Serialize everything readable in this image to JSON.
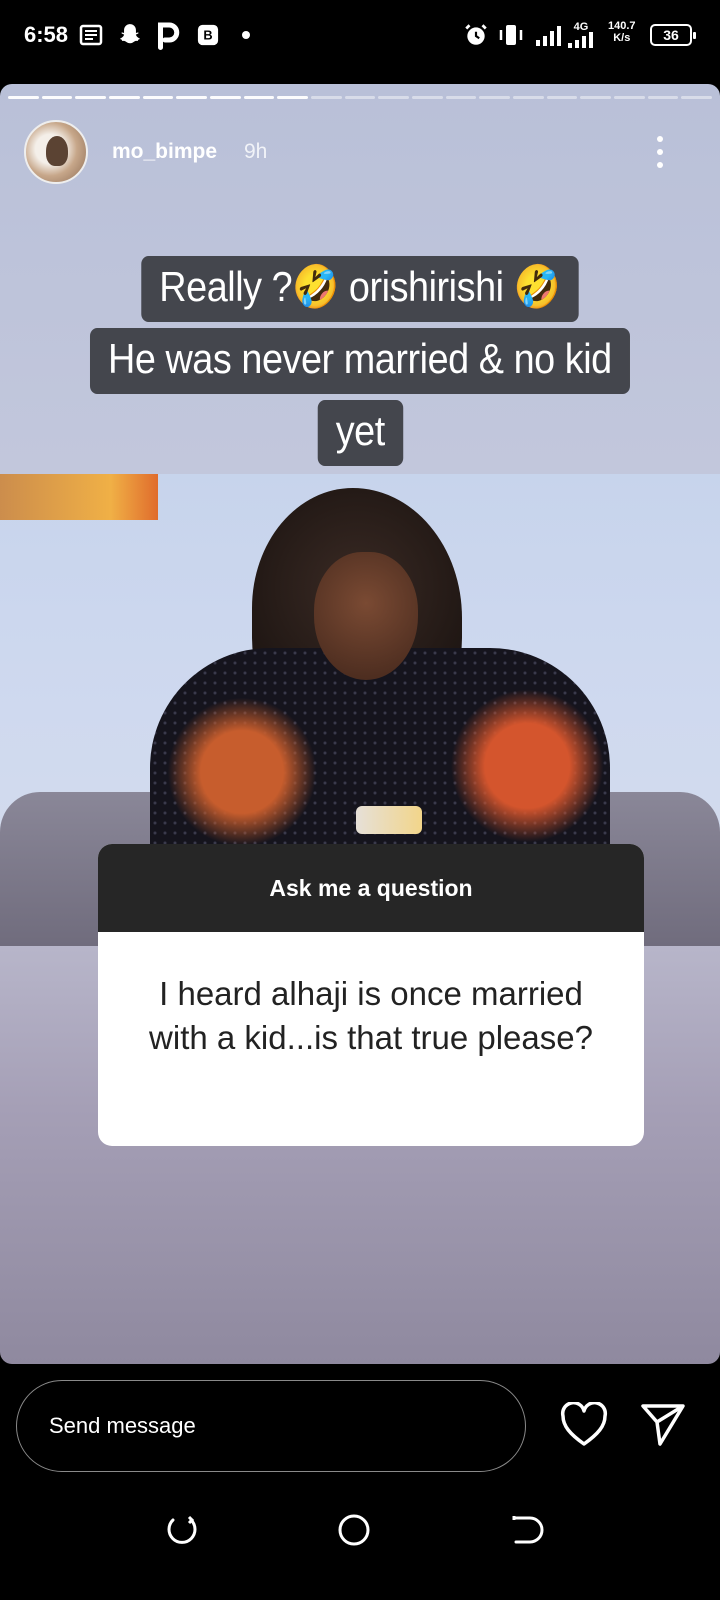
{
  "status_bar": {
    "time": "6:58",
    "network": "4G",
    "speed": "140.7",
    "speed_unit": "K/s",
    "battery": "36",
    "icons": [
      "news-icon",
      "snapchat-icon",
      "p-app-icon",
      "bitcoin-icon",
      "dot-icon",
      "alarm-icon",
      "vibrate-icon",
      "signal-icon",
      "signal-4g-icon",
      "battery-icon"
    ]
  },
  "story": {
    "progress_total": 21,
    "progress_done": 9,
    "username": "mo_bimpe",
    "time_ago": "9h",
    "caption_lines": [
      "Really ?🤣 orishirishi 🤣",
      "He was never married & no kid",
      "yet"
    ],
    "question": {
      "title": "Ask me a question",
      "text": "I heard alhaji is once married with a kid...is that true please?"
    }
  },
  "reply_bar": {
    "placeholder": "Send message"
  },
  "colors": {
    "caption_bg": "#44464d",
    "question_header_bg": "#262626",
    "background": "#000000"
  }
}
